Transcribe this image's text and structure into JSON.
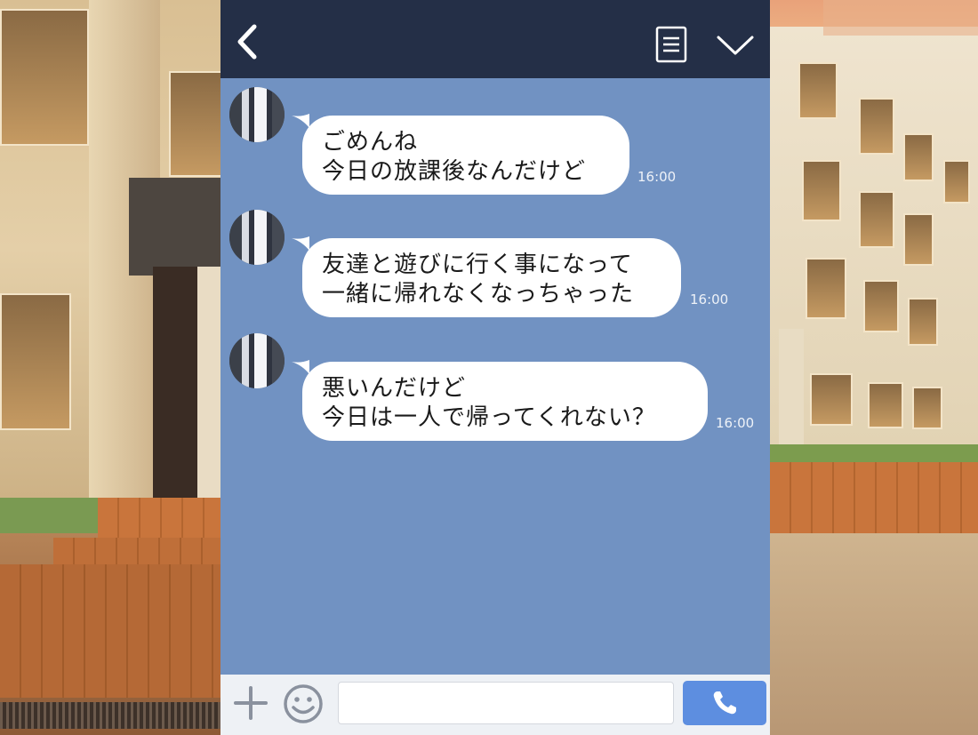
{
  "header": {
    "back_icon": "chevron-left-icon",
    "menu_icon": "document-list-icon",
    "collapse_icon": "chevron-down-icon"
  },
  "messages": [
    {
      "lines": [
        "ごめんね",
        "今日の放課後なんだけど"
      ],
      "time": "16:00"
    },
    {
      "lines": [
        "友達と遊びに行く事になって",
        "一緒に帰れなくなっちゃった"
      ],
      "time": "16:00"
    },
    {
      "lines": [
        "悪いんだけど",
        "今日は一人で帰ってくれない？"
      ],
      "time": "16:00"
    }
  ],
  "composer": {
    "placeholder": "",
    "value": "",
    "plus_icon": "plus-icon",
    "emoji_icon": "smiley-icon",
    "call_icon": "phone-icon"
  },
  "colors": {
    "header_bg": "#242f47",
    "chat_bg": "#7192c2",
    "bubble_bg": "#ffffff",
    "composer_bg": "#eef1f5",
    "call_button": "#5d8ee0"
  }
}
